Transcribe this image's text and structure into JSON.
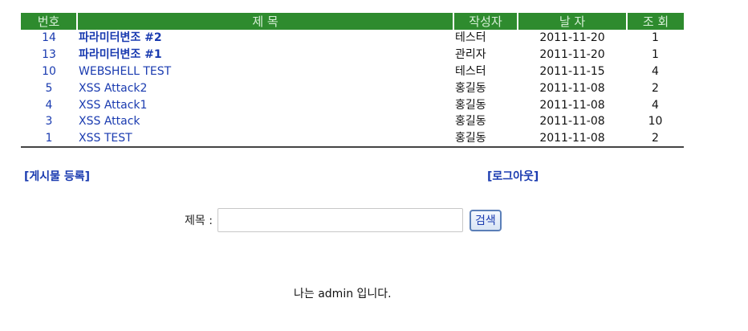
{
  "table": {
    "headers": {
      "num": "번호",
      "title": "제 목",
      "author": "작성자",
      "date": "날 자",
      "views": "조 회"
    },
    "rows": [
      {
        "num": "14",
        "title": "파라미터변조 #2",
        "author": "테스터",
        "date": "2011-11-20",
        "views": "1"
      },
      {
        "num": "13",
        "title": "파라미터변조 #1",
        "author": "관리자",
        "date": "2011-11-20",
        "views": "1"
      },
      {
        "num": "10",
        "title": "WEBSHELL TEST",
        "author": "테스터",
        "date": "2011-11-15",
        "views": "4"
      },
      {
        "num": "5",
        "title": "XSS Attack2",
        "author": "홍길동",
        "date": "2011-11-08",
        "views": "2"
      },
      {
        "num": "4",
        "title": "XSS Attack1",
        "author": "홍길동",
        "date": "2011-11-08",
        "views": "4"
      },
      {
        "num": "3",
        "title": "XSS Attack",
        "author": "홍길동",
        "date": "2011-11-08",
        "views": "10"
      },
      {
        "num": "1",
        "title": "XSS TEST",
        "author": "홍길동",
        "date": "2011-11-08",
        "views": "2"
      }
    ]
  },
  "links": {
    "register": "[게시물 등록]",
    "logout": "[로그아웃]"
  },
  "search": {
    "label": "제목 :",
    "value": "",
    "button": "검색"
  },
  "footer": {
    "welcome": "나는 admin 입니다."
  },
  "colors": {
    "header_bg": "#2e8b2e",
    "link": "#1a3bb0"
  }
}
